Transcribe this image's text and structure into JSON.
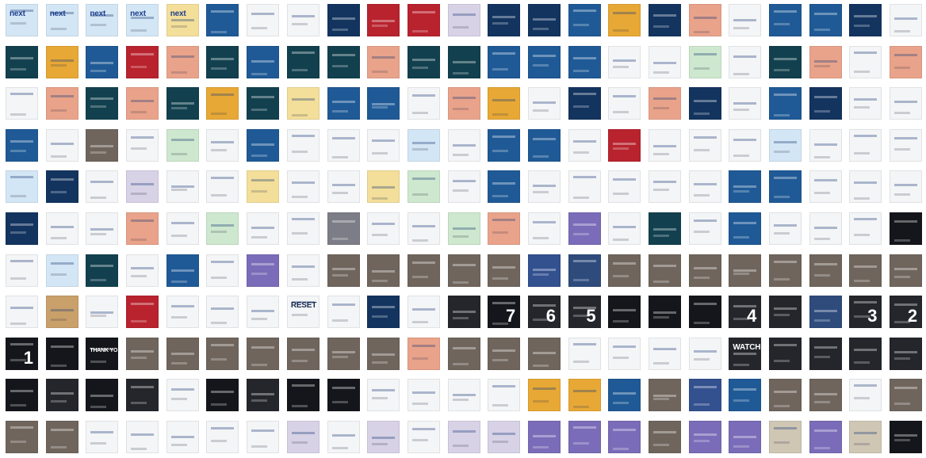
{
  "palette": {
    "W": "#f4f5f7",
    "N": "#13345f",
    "B": "#1f5a96",
    "T": "#12404e",
    "D": "#24262c",
    "K": "#14161b",
    "P": "#e9a38a",
    "Y": "#f3df9a",
    "O": "#e7a835",
    "R": "#b8232e",
    "G": "#cde8ce",
    "L": "#d3e6f5",
    "M": "#d8d2e6",
    "X": "#7c7d86",
    "C": "#c9a06a",
    "Q": "#a57bc9",
    "U": "#7a6cb8",
    "E": "#6f655d",
    "S": "#cfc6b4",
    "H": "#2e4b7c",
    "V": "#33508f"
  },
  "rows": [
    "LLLLYBWWNRRMNNBONPWBBNW",
    "TOBRPTBTTPTTBBBWWGWTPWP",
    "WPTPTOTYBBWPOWNWPNWBNWW",
    "BWEWGWBWWWLWBBWRWWWLWWW",
    "LNWMWWYWWYGWBWWWWWBBWWW",
    "NWWPWGWWXWWGPWUWTWBWWWK",
    "WLTWBWUWEEEEEVHEEEEEEEE",
    "WCWRWWWWWNWDKDDKKKDDHDD",
    "KKKEEEEEEEPEEEWWWWDDDDD",
    "KDKDWKDKKWWWWOOBEVBEEWE",
    "EEWWWWWMWMWMMUUUEUUSUSK"
  ],
  "tiles": [
    {
      "row": 0,
      "col": 0,
      "text": "next"
    },
    {
      "row": 0,
      "col": 1,
      "text": "next"
    },
    {
      "row": 0,
      "col": 2,
      "text": "next"
    },
    {
      "row": 0,
      "col": 3,
      "text": "next"
    },
    {
      "row": 0,
      "col": 4,
      "text": "next"
    },
    {
      "row": 7,
      "col": 7,
      "text": "RESET"
    },
    {
      "row": 7,
      "col": 12,
      "text": "7"
    },
    {
      "row": 7,
      "col": 13,
      "text": "6"
    },
    {
      "row": 7,
      "col": 14,
      "text": "5"
    },
    {
      "row": 7,
      "col": 18,
      "text": "4"
    },
    {
      "row": 7,
      "col": 21,
      "text": "3"
    },
    {
      "row": 7,
      "col": 22,
      "text": "2"
    },
    {
      "row": 8,
      "col": 0,
      "text": "1"
    },
    {
      "row": 8,
      "col": 2,
      "text": "THANK YOU"
    },
    {
      "row": 8,
      "col": 18,
      "text": "WATCH"
    }
  ]
}
